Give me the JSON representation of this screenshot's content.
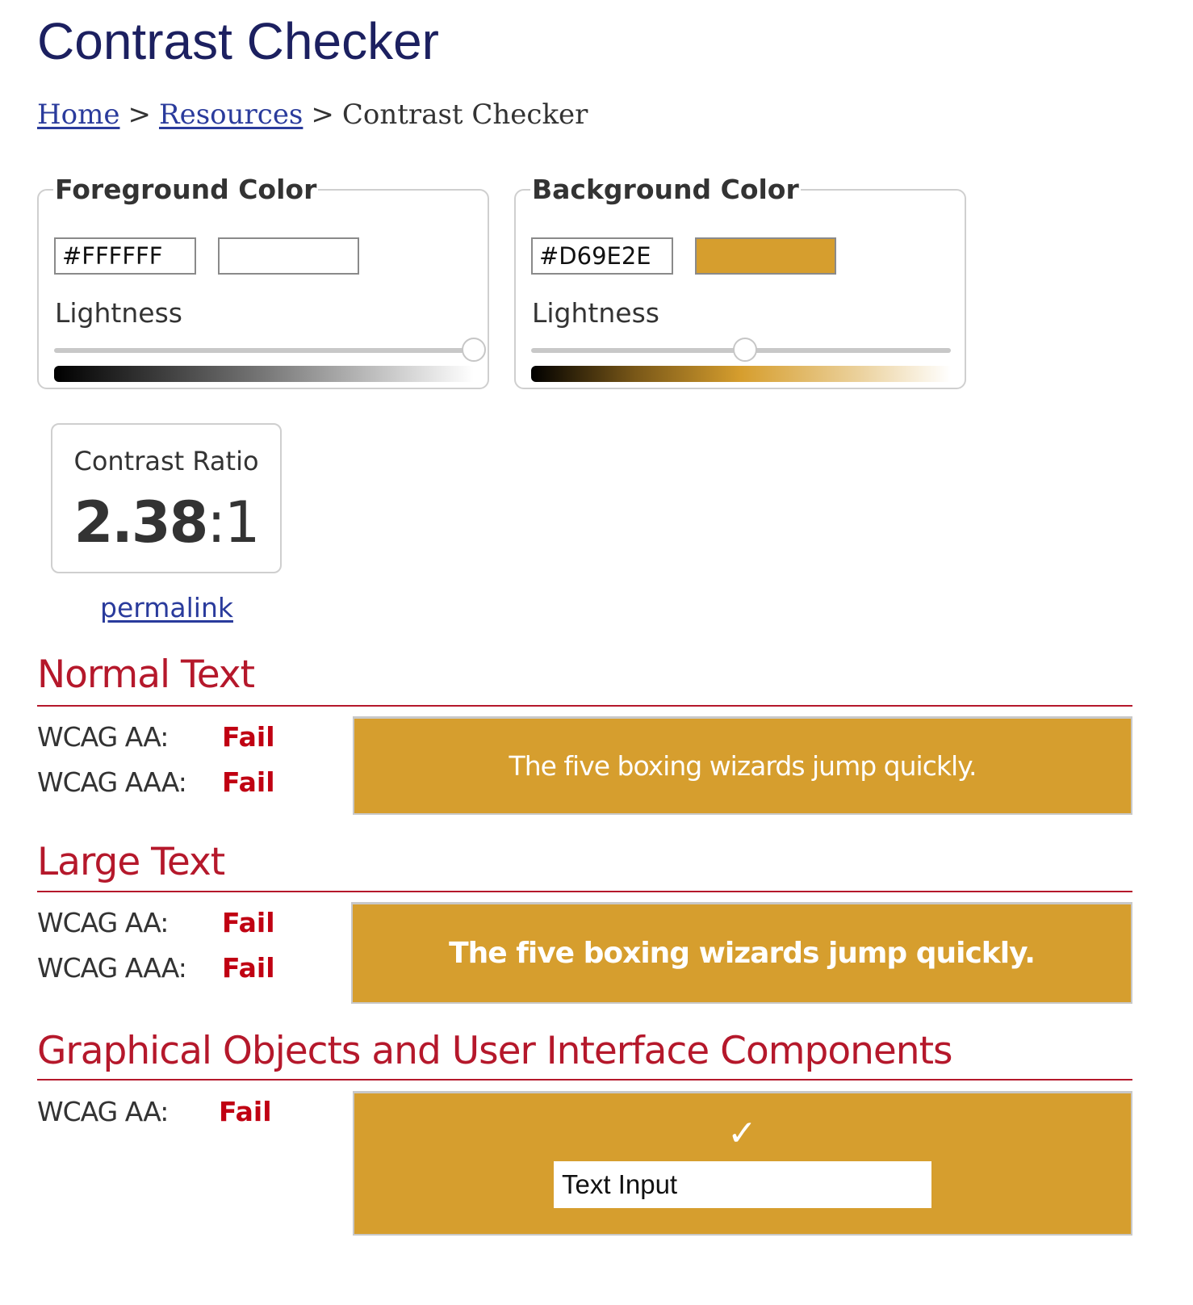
{
  "page": {
    "title": "Contrast Checker",
    "breadcrumb": [
      {
        "label": "Home",
        "link": true
      },
      {
        "label": "Resources",
        "link": true
      },
      {
        "label": "Contrast Checker",
        "link": false
      }
    ],
    "separator": ">"
  },
  "foreground": {
    "legend": "Foreground Color",
    "hex_value": "#FFFFFF",
    "swatch_color": "#FFFFFF",
    "lightness_label": "Lightness",
    "lightness_percent": 100
  },
  "background": {
    "legend": "Background Color",
    "hex_value": "#D69E2E",
    "swatch_color": "#D69E2E",
    "lightness_label": "Lightness",
    "lightness_percent": 51
  },
  "contrast": {
    "label": "Contrast Ratio",
    "ratio_bold": "2.38",
    "ratio_suffix": ":1",
    "permalink_label": "permalink"
  },
  "sections": {
    "normal": {
      "heading": "Normal Text",
      "results": [
        {
          "label": "WCAG AA:",
          "result": "Fail"
        },
        {
          "label": "WCAG AAA:",
          "result": "Fail"
        }
      ],
      "sample_text": "The five boxing wizards jump quickly."
    },
    "large": {
      "heading": "Large Text",
      "results": [
        {
          "label": "WCAG AA:",
          "result": "Fail"
        },
        {
          "label": "WCAG AAA:",
          "result": "Fail"
        }
      ],
      "sample_text": "The five boxing wizards jump quickly."
    },
    "ui": {
      "heading": "Graphical Objects and User Interface Components",
      "results": [
        {
          "label": "WCAG AA:",
          "result": "Fail"
        }
      ],
      "check_icon": "✓",
      "input_value": "Text Input"
    }
  },
  "colors": {
    "title": "#1c2060",
    "link": "#2a3b9c",
    "heading": "#b5182b",
    "fail": "#c00012"
  }
}
